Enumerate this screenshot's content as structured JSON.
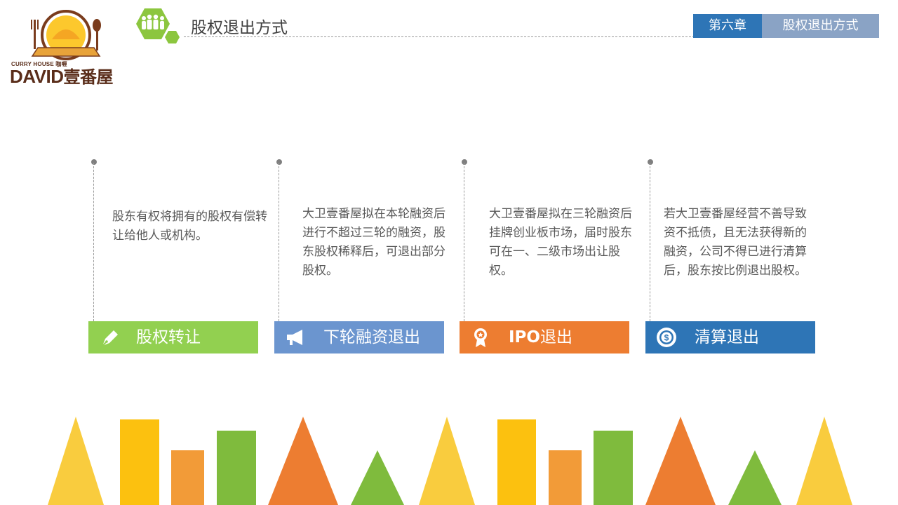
{
  "logo": {
    "subtitle": "CURRY HOUSE 咖喱",
    "brand_en": "DAVID",
    "brand_cn": "壹番屋",
    "icon": "restaurant-logo"
  },
  "header": {
    "title": "股权退出方式",
    "icon": "people-group-icon",
    "chapter": "第六章",
    "section": "股权退出方式"
  },
  "columns": [
    {
      "title": "股权转让",
      "icon": "pen-icon",
      "color": "#92d050",
      "description": "股东有权将拥有的股权有偿转让给他人或机构。"
    },
    {
      "title": "下轮融资退出",
      "icon": "megaphone-icon",
      "color": "#6b95cf",
      "description": "大卫壹番屋拟在本轮融资后进行不超过三轮的融资，股东股权稀释后，可退出部分股权。"
    },
    {
      "title_prefix": "IPO",
      "title_suffix": "退出",
      "icon": "medal-icon",
      "color": "#ed7d31",
      "description": "大卫壹番屋拟在三轮融资后挂牌创业板市场，届时股东可在一、二级市场出让股权。"
    },
    {
      "title": "清算退出",
      "icon": "coin-icon",
      "color": "#2e75b6",
      "description": "若大卫壹番屋经营不善导致资不抵债，且无法获得新的融资，公司不得已进行清算后，股东按比例退出股权。"
    }
  ],
  "colors": {
    "chapter_bg": "#2e75b6",
    "section_bg": "#8aa3c5",
    "green": "#92d050",
    "blue": "#6b95cf",
    "orange": "#ed7d31",
    "navy": "#2e75b6",
    "yellow": "#fcc82d",
    "deco_green": "#7fbb3d",
    "deco_orange": "#f29b38"
  }
}
